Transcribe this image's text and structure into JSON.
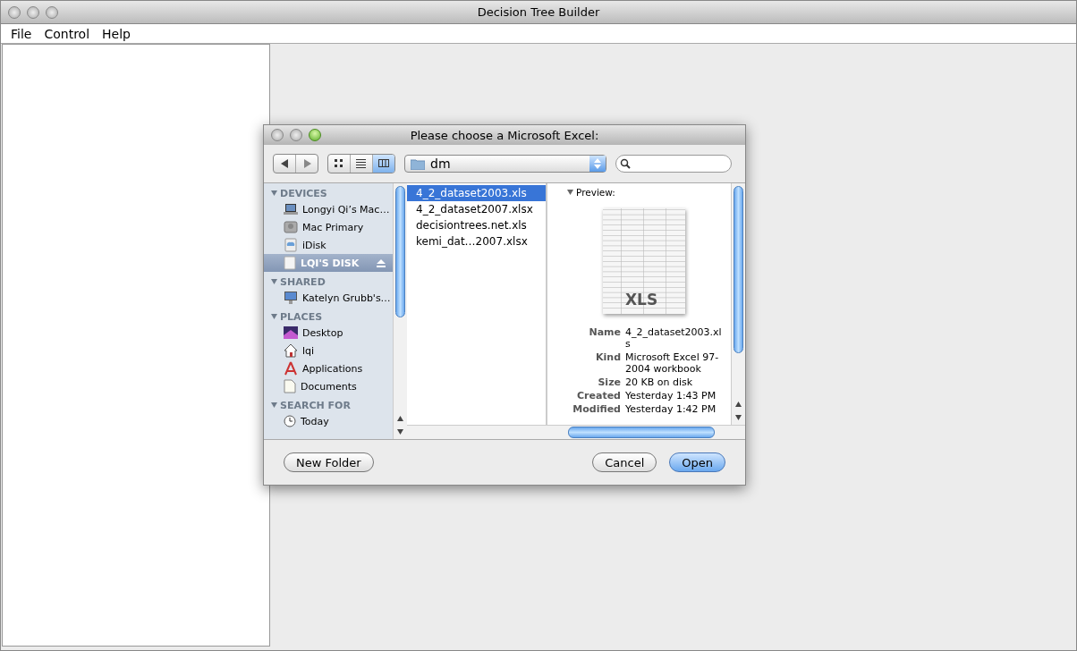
{
  "window": {
    "title": "Decision Tree Builder"
  },
  "menu": [
    "File",
    "Control",
    "Help"
  ],
  "dialog": {
    "title": "Please choose a Microsoft Excel:",
    "views": [
      {
        "kind": "icons",
        "selected": false
      },
      {
        "kind": "list",
        "selected": false
      },
      {
        "kind": "columns",
        "selected": true
      }
    ],
    "location": "dm",
    "sidebar": [
      {
        "heading": "DEVICES",
        "items": [
          {
            "label": "Longyi Qi’s Mac…",
            "kind": "laptop",
            "selected": false
          },
          {
            "label": "Mac Primary",
            "kind": "drive",
            "selected": false
          },
          {
            "label": "iDisk",
            "kind": "idisk",
            "selected": false
          },
          {
            "label": "LQI'S DISK",
            "kind": "disk",
            "selected": true,
            "eject": true
          }
        ]
      },
      {
        "heading": "SHARED",
        "items": [
          {
            "label": "Katelyn Grubb's…",
            "kind": "monitor",
            "selected": false
          }
        ]
      },
      {
        "heading": "PLACES",
        "items": [
          {
            "label": "Desktop",
            "kind": "desktop",
            "selected": false
          },
          {
            "label": "lqi",
            "kind": "home",
            "selected": false
          },
          {
            "label": "Applications",
            "kind": "apps",
            "selected": false
          },
          {
            "label": "Documents",
            "kind": "documents",
            "selected": false
          }
        ]
      },
      {
        "heading": "SEARCH FOR",
        "items": [
          {
            "label": "Today",
            "kind": "clock",
            "selected": false
          }
        ]
      }
    ],
    "files": [
      {
        "name": "4_2_dataset2003.xls",
        "selected": true
      },
      {
        "name": "4_2_dataset2007.xlsx",
        "selected": false
      },
      {
        "name": "decisiontrees.net.xls",
        "selected": false
      },
      {
        "name": "kemi_dat…2007.xlsx",
        "selected": false
      }
    ],
    "preview": {
      "heading": "Preview:",
      "thumbnail_label": "XLS",
      "details": [
        {
          "label": "Name",
          "value": "4_2_dataset2003.xl s"
        },
        {
          "label": "Kind",
          "value": "Microsoft Excel 97-2004 workbook"
        },
        {
          "label": "Size",
          "value": "20 KB on disk"
        },
        {
          "label": "Created",
          "value": "Yesterday 1:43 PM"
        },
        {
          "label": "Modified",
          "value": "Yesterday 1:42 PM"
        }
      ]
    },
    "buttons": [
      {
        "label": "New Folder",
        "kind": "left"
      },
      {
        "label": "Cancel",
        "kind": "normal"
      },
      {
        "label": "Open",
        "kind": "default"
      }
    ]
  }
}
